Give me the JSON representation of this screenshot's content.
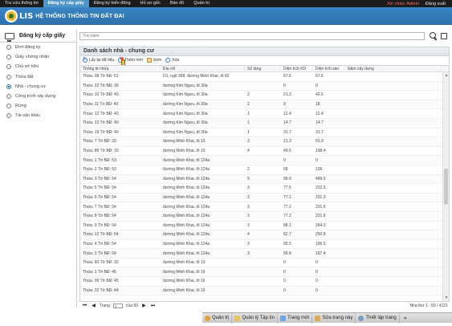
{
  "topnav": {
    "items": [
      "Tra cứu thông tin",
      "Đăng ký cấp giấy",
      "Đăng ký biến động",
      "Hồ sơ gốc",
      "Bản đồ",
      "Quản trị"
    ],
    "active_index": 1,
    "greeting": "Xin chào: Admin",
    "logout": "Đăng xuất"
  },
  "banner": {
    "logo_text": "LIS",
    "title": "HỆ THỐNG THÔNG TIN ĐẤT ĐAI"
  },
  "sidebar": {
    "title": "Đăng ký cấp giấy",
    "items": [
      {
        "label": "Đơn đăng ký",
        "active": false
      },
      {
        "label": "Giấy chứng nhận",
        "active": false
      },
      {
        "label": "Chủ sở hữu",
        "active": false
      },
      {
        "label": "Thửa đất",
        "active": false
      },
      {
        "label": "Nhà - chung cư",
        "active": true
      },
      {
        "label": "Công trình xây dựng",
        "active": false
      },
      {
        "label": "Rừng",
        "active": false
      },
      {
        "label": "Tài sản khác",
        "active": false
      }
    ]
  },
  "search": {
    "placeholder": "Tìm kiếm"
  },
  "panel": {
    "title": "Danh sách nhà - chung cư"
  },
  "toolbar": {
    "refresh": "Lấy lại dữ liệu",
    "add": "Thêm mới",
    "view": "Xem",
    "delete": "Xóa"
  },
  "grid": {
    "columns": [
      "Thông tin thửa",
      "Địa chỉ",
      "Số tầng",
      "Diện tích XD",
      "Diện tích sàn",
      "Năm xây dựng"
    ],
    "rows": [
      [
        "Thửa: 38 Tờ BĐ: 51",
        "D1, ngõ 308, đường Minh Khai, tổ 82",
        "",
        "57.6",
        "57.6",
        ""
      ],
      [
        "Thửa: 22 Tờ BĐ: 39",
        "đường Kim Ngưu, tổ 30a",
        "",
        "0",
        "0",
        ""
      ],
      [
        "Thửa: 10 Tờ BĐ: 40",
        "đường Kim Ngưu, tổ 30a",
        "2",
        "21.3",
        "42.6",
        ""
      ],
      [
        "Thửa: 11 Tờ BĐ: 40",
        "đường Kim Ngưu, tổ 30a",
        "2",
        "9",
        "18",
        ""
      ],
      [
        "Thửa: 12 Tờ BĐ: 40",
        "đường Kim Ngưu, tổ 30a",
        "1",
        "12.4",
        "12.4",
        ""
      ],
      [
        "Thửa: 13 Tờ BĐ: 40",
        "đường Kim Ngưu, tổ 30a",
        "1",
        "14.7",
        "14.7",
        ""
      ],
      [
        "Thửa: 19 Tờ BĐ: 40",
        "đường Kim Ngưu, tổ 30a",
        "1",
        "31.7",
        "31.7",
        ""
      ],
      [
        "Thửa: 7 Tờ BĐ: 33",
        "đường Minh Khai, tổ 10",
        "3",
        "21.3",
        "63.9",
        ""
      ],
      [
        "Thửa: 89 Tờ BĐ: 33",
        "đường Minh Khai, tổ 10",
        "4",
        "49.6",
        "198.4",
        ""
      ],
      [
        "Thửa: 1 Tờ BĐ: 53",
        "đường Minh Khai, tổ 124a",
        "",
        "0",
        "0",
        ""
      ],
      [
        "Thửa: 2 Tờ BĐ: 53",
        "đường Minh Khai, tổ 124a",
        "2",
        "68",
        "136",
        ""
      ],
      [
        "Thửa: 3 Tờ BĐ: 54",
        "đường Minh Khai, tổ 124a",
        "5",
        "99.9",
        "499.5",
        ""
      ],
      [
        "Thửa: 5 Tờ BĐ: 54",
        "đường Minh Khai, tổ 124a",
        "3",
        "77.5",
        "232.5",
        ""
      ],
      [
        "Thửa: 6 Tờ BĐ: 54",
        "đường Minh Khai, tổ 124a",
        "3",
        "77.1",
        "231.3",
        ""
      ],
      [
        "Thửa: 7 Tờ BĐ: 54",
        "đường Minh Khai, tổ 124a",
        "3",
        "77.2",
        "231.6",
        ""
      ],
      [
        "Thửa: 8 Tờ BĐ: 54",
        "đường Minh Khai, tổ 124a",
        "3",
        "77.2",
        "231.6",
        ""
      ],
      [
        "Thửa: 9 Tờ BĐ: 54",
        "đường Minh Khai, tổ 124a",
        "3",
        "88.1",
        "264.3",
        ""
      ],
      [
        "Thửa: 12 Tờ BĐ: 54",
        "đường Minh Khai, tổ 124a",
        "4",
        "62.7",
        "250.8",
        ""
      ],
      [
        "Thửa: 4 Tờ BĐ: 54",
        "đường Minh Khai, tổ 124a",
        "3",
        "65.5",
        "196.5",
        ""
      ],
      [
        "Thửa: 3 Tờ BĐ: 54",
        "đường Minh Khai, tổ 124a",
        "3",
        "65.8",
        "197.4",
        ""
      ],
      [
        "Thửa: 60 Tờ BĐ: 32",
        "đường Minh Khai, tổ 13",
        "",
        "0",
        "0",
        ""
      ],
      [
        "Thửa: 1 Tờ BĐ: 45",
        "đường Minh Khai, tổ 16",
        "",
        "0",
        "0",
        ""
      ],
      [
        "Thửa: 99 Tờ BĐ: 45",
        "đường Minh Khai, tổ 16",
        "",
        "0",
        "0",
        ""
      ],
      [
        "Thửa: 22 Tờ BĐ: 44",
        "đường Minh Khai, tổ 16",
        "",
        "0",
        "0",
        ""
      ]
    ]
  },
  "pager": {
    "page_label": "Trang",
    "page_value": "1",
    "of_label": "của 83",
    "info": "Nhà thứ 1 - 50 / 4121"
  },
  "bottombar": {
    "items": [
      "Quản trị",
      "Quản lý Tập tin",
      "Trang mới",
      "Sửa trang này",
      "Thiết lập trang"
    ],
    "icons": [
      "key-icon",
      "folder-icon",
      "page-icon",
      "edit-icon",
      "settings-icon"
    ]
  }
}
